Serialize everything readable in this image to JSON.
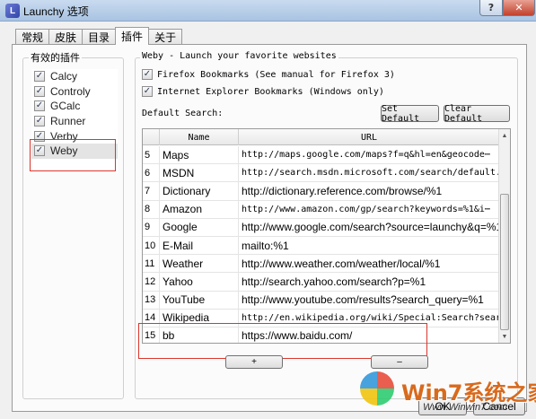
{
  "window": {
    "title": "Launchy 选项",
    "help": "?",
    "close": "✕"
  },
  "tabs": [
    "常规",
    "皮肤",
    "目录",
    "插件",
    "关于"
  ],
  "active_tab": 3,
  "plugins": {
    "legend": "有效的插件",
    "items": [
      {
        "label": "Calcy",
        "checked": true
      },
      {
        "label": "Controly",
        "checked": true
      },
      {
        "label": "GCalc",
        "checked": true
      },
      {
        "label": "Runner",
        "checked": true
      },
      {
        "label": "Verby",
        "checked": true
      },
      {
        "label": "Weby",
        "checked": true
      }
    ]
  },
  "weby": {
    "legend": "Weby - Launch your favorite websites",
    "firefox_label": "Firefox Bookmarks (See manual for Firefox 3)",
    "ie_label": "Internet Explorer Bookmarks (Windows only)",
    "default_search_label": "Default Search:",
    "set_default": "Set Default",
    "clear_default": "Clear Default",
    "grid": {
      "headers": {
        "name": "Name",
        "url": "URL"
      },
      "rows": [
        {
          "num": "5",
          "name": "Maps",
          "url": "http://maps.google.com/maps?f=q&hl=en&geocode⋯"
        },
        {
          "num": "6",
          "name": "MSDN",
          "url": "http://search.msdn.microsoft.com/search/default.asp⋯"
        },
        {
          "num": "7",
          "name": "Dictionary",
          "url": "http://dictionary.reference.com/browse/%1"
        },
        {
          "num": "8",
          "name": "Amazon",
          "url": "http://www.amazon.com/gp/search?keywords=%1&i⋯"
        },
        {
          "num": "9",
          "name": "Google",
          "url": "http://www.google.com/search?source=launchy&q=%1"
        },
        {
          "num": "10",
          "name": "E-Mail",
          "url": "mailto:%1"
        },
        {
          "num": "11",
          "name": "Weather",
          "url": "http://www.weather.com/weather/local/%1"
        },
        {
          "num": "12",
          "name": "Yahoo",
          "url": "http://search.yahoo.com/search?p=%1"
        },
        {
          "num": "13",
          "name": "YouTube",
          "url": "http://www.youtube.com/results?search_query=%1"
        },
        {
          "num": "14",
          "name": "Wikipedia",
          "url": "http://en.wikipedia.org/wiki/Special:Search?search=%⋯"
        },
        {
          "num": "15",
          "name": "bb",
          "url": "https://www.baidu.com/"
        }
      ]
    },
    "add_button": "+",
    "remove_button": "–"
  },
  "footer": {
    "ok_label": "OK",
    "cancel_label": "Cancel"
  },
  "watermark": {
    "title": "Win7系统之家",
    "url": "Www.Winwin7.com"
  }
}
